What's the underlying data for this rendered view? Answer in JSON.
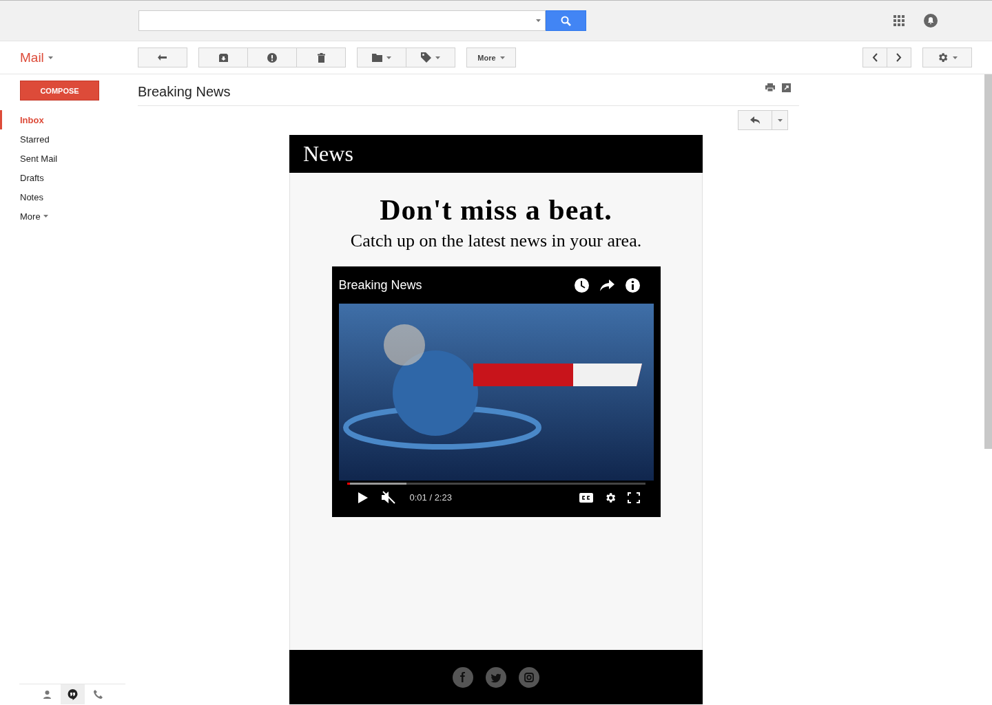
{
  "app_menu": "Mail",
  "toolbar": {
    "more_button": "More"
  },
  "sidebar": {
    "compose": "COMPOSE",
    "items": [
      {
        "label": "Inbox",
        "selected": true
      },
      {
        "label": "Starred",
        "selected": false
      },
      {
        "label": "Sent Mail",
        "selected": false
      },
      {
        "label": "Drafts",
        "selected": false
      },
      {
        "label": "Notes",
        "selected": false
      },
      {
        "label": "More",
        "selected": false,
        "kind": "dropdown"
      }
    ],
    "bottom_tabs": [
      {
        "kind": "contacts",
        "selected": false
      },
      {
        "kind": "hangouts",
        "selected": true
      },
      {
        "kind": "phone",
        "selected": false
      }
    ]
  },
  "message": {
    "subject": "Breaking News",
    "email": {
      "brand": "News",
      "headline": "Don't miss a beat.",
      "subheadline": "Catch up on the latest news in your area.",
      "video": {
        "title": "Breaking News",
        "time": "0:01 / 2:23",
        "progress": {
          "level": 0.01
        },
        "buffer": {
          "level": 0.2
        },
        "muted": true
      }
    }
  }
}
